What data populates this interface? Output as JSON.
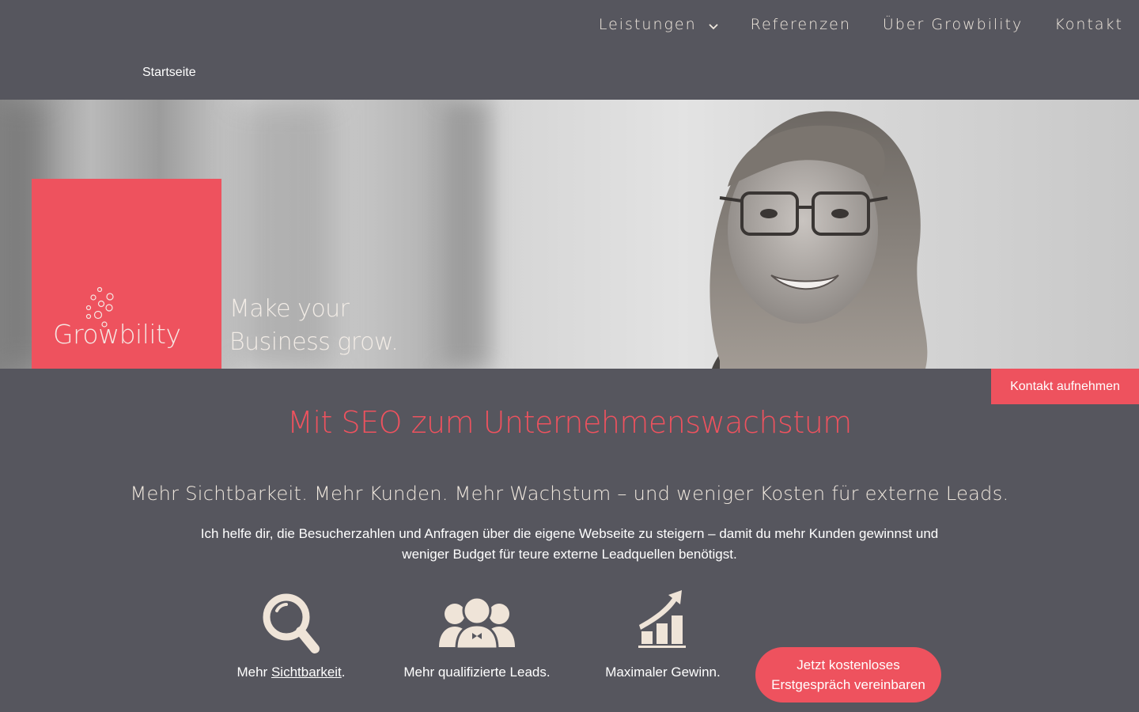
{
  "nav": {
    "items": [
      {
        "label": "Leistungen",
        "has_dropdown": true
      },
      {
        "label": "Referenzen"
      },
      {
        "label": "Über Growbility"
      },
      {
        "label": "Kontakt"
      }
    ]
  },
  "breadcrumb": "Startseite",
  "hero": {
    "logo_text": "Growbility",
    "tagline_line1": "Make your",
    "tagline_line2": "Business grow."
  },
  "contact_tab": "Kontakt aufnehmen",
  "main": {
    "headline": "Mit SEO zum Unternehmenswachstum",
    "subheadline": "Mehr Sichtbarkeit. Mehr Kunden. Mehr Wachstum – und weniger Kosten für externe Leads.",
    "intro": "Ich helfe dir, die Besucherzahlen und Anfragen über die eigene Webseite zu steigern – damit du mehr Kunden gewinnst und weniger Budget für teure externe Leadquellen benötigst."
  },
  "features": [
    {
      "prefix": "Mehr ",
      "link": "Sichtbarkeit",
      "suffix": ".",
      "icon": "magnifier-icon"
    },
    {
      "label": "Mehr qualifizierte Leads.",
      "icon": "people-group-icon"
    },
    {
      "label": "Maximaler Gewinn.",
      "icon": "growth-chart-icon"
    }
  ],
  "cta": {
    "line1": "Jetzt kostenloses",
    "line2": "Erstgespräch vereinbaren"
  },
  "colors": {
    "background": "#56565e",
    "accent": "#ee525e",
    "text": "#f1e9df"
  }
}
